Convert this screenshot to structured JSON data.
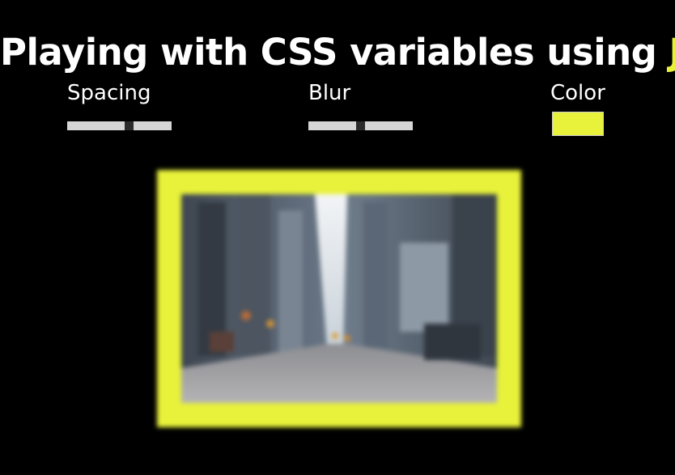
{
  "page": {
    "title_prefix": "Playing with CSS variables using ",
    "title_highlight": "JS"
  },
  "controls": {
    "spacing": {
      "label": "Spacing",
      "value_fraction": 0.6
    },
    "blur": {
      "label": "Blur",
      "value_fraction": 0.5
    },
    "color": {
      "label": "Color",
      "value": "#e8f23a"
    }
  },
  "colors": {
    "background": "#000000",
    "accent": "#e8f23a",
    "slider_track": "#d6d6d6",
    "slider_thumb": "#2b2b2b"
  },
  "image": {
    "subject": "city street between tall buildings"
  }
}
